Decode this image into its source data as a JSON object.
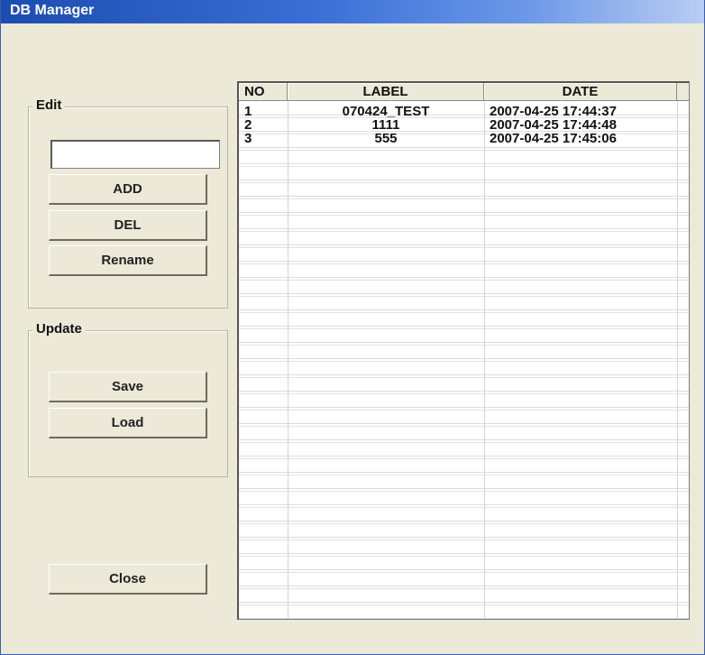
{
  "window": {
    "title": "DB Manager"
  },
  "edit_group": {
    "label": "Edit",
    "input_value": "",
    "add_label": "ADD",
    "del_label": "DEL",
    "rename_label": "Rename"
  },
  "update_group": {
    "label": "Update",
    "save_label": "Save",
    "load_label": "Load"
  },
  "close_label": "Close",
  "table": {
    "columns": [
      "NO",
      "LABEL",
      "DATE"
    ],
    "rows": [
      {
        "no": "1",
        "label": "070424_TEST",
        "date": "2007-04-25  17:44:37"
      },
      {
        "no": "2",
        "label": "1111",
        "date": "2007-04-25  17:44:48"
      },
      {
        "no": "3",
        "label": "555",
        "date": "2007-04-25  17:45:06"
      }
    ]
  }
}
